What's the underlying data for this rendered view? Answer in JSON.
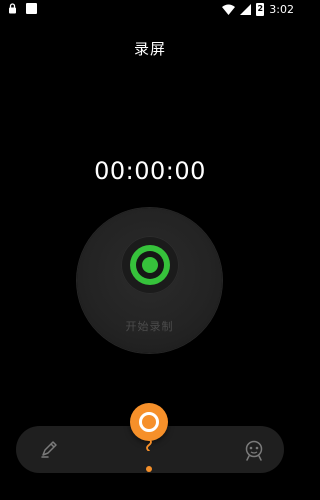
{
  "status_bar": {
    "time": "3:02",
    "battery_level": "2",
    "icons": [
      "lock-icon",
      "notification-icon",
      "wifi-icon",
      "signal-icon",
      "battery-icon"
    ]
  },
  "header": {
    "title": "录屏"
  },
  "recorder": {
    "timer": "00:00:00",
    "start_label": "开始录制"
  },
  "bottom_nav": {
    "items": [
      "pen-icon",
      "record-float-icon",
      "robot-icon"
    ],
    "accent_color": "#f6902a",
    "record_color": "#36c23b"
  }
}
